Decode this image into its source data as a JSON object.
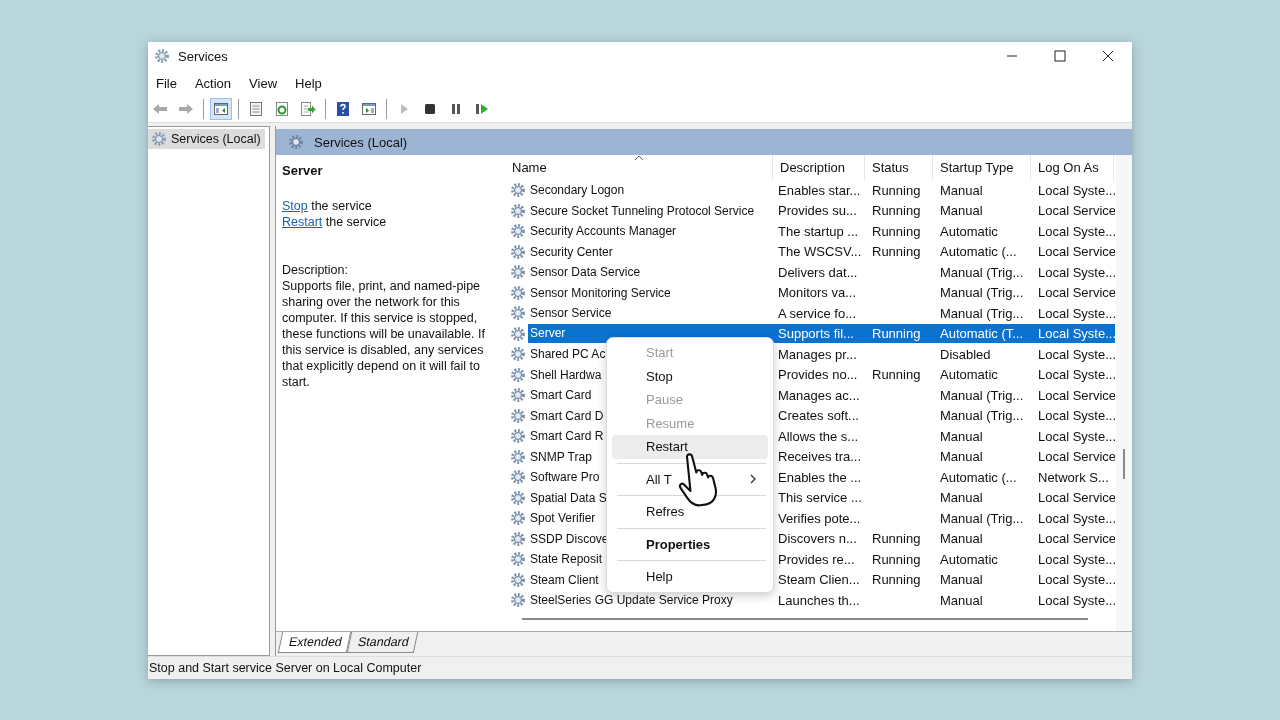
{
  "window": {
    "title": "Services"
  },
  "menu": [
    "File",
    "Action",
    "View",
    "Help"
  ],
  "toolbar": [
    {
      "kind": "back",
      "disabled": true,
      "selected": false
    },
    {
      "kind": "forward",
      "disabled": true,
      "selected": false
    },
    {
      "kind": "separator"
    },
    {
      "kind": "tree",
      "disabled": false,
      "selected": true
    },
    {
      "kind": "separator"
    },
    {
      "kind": "properties",
      "disabled": false,
      "selected": false
    },
    {
      "kind": "refresh",
      "disabled": false,
      "selected": false
    },
    {
      "kind": "export",
      "disabled": false,
      "selected": false
    },
    {
      "kind": "separator"
    },
    {
      "kind": "help",
      "disabled": false,
      "selected": false
    },
    {
      "kind": "view",
      "disabled": false,
      "selected": false
    },
    {
      "kind": "separator"
    },
    {
      "kind": "play",
      "disabled": true,
      "selected": false
    },
    {
      "kind": "stop",
      "disabled": false,
      "selected": false
    },
    {
      "kind": "pause",
      "disabled": false,
      "selected": false
    },
    {
      "kind": "resume",
      "disabled": false,
      "selected": false
    }
  ],
  "tree": {
    "items": [
      {
        "label": "Services (Local)",
        "selected": true
      }
    ]
  },
  "panel": {
    "header": "Services (Local)"
  },
  "details": {
    "title": "Server",
    "actions": [
      {
        "link": "Stop",
        "text": "the service"
      },
      {
        "link": "Restart",
        "text": "the service"
      }
    ],
    "description_label": "Description:",
    "description": "Supports file, print, and named-pipe sharing over the network for this computer. If this service is stopped, these functions will be unavailable. If this service is disabled, any services that explicitly depend on it will fail to start."
  },
  "table": {
    "columns": [
      {
        "label": "Name",
        "sorted": true
      },
      {
        "label": "Description",
        "sorted": false
      },
      {
        "label": "Status",
        "sorted": false
      },
      {
        "label": "Startup Type",
        "sorted": false
      },
      {
        "label": "Log On As",
        "sorted": false
      }
    ],
    "rows": [
      {
        "name": "Secondary Logon",
        "description": "Enables star...",
        "status": "Running",
        "startup_type": "Manual",
        "log_on_as": "Local Syste...",
        "selected": false
      },
      {
        "name": "Secure Socket Tunneling Protocol Service",
        "description": "Provides su...",
        "status": "Running",
        "startup_type": "Manual",
        "log_on_as": "Local Service",
        "selected": false
      },
      {
        "name": "Security Accounts Manager",
        "description": "The startup ...",
        "status": "Running",
        "startup_type": "Automatic",
        "log_on_as": "Local Syste...",
        "selected": false
      },
      {
        "name": "Security Center",
        "description": "The WSCSV...",
        "status": "Running",
        "startup_type": "Automatic (...",
        "log_on_as": "Local Service",
        "selected": false
      },
      {
        "name": "Sensor Data Service",
        "description": "Delivers dat...",
        "startup_type": "Manual (Trig...",
        "log_on_as": "Local Syste...",
        "selected": false
      },
      {
        "name": "Sensor Monitoring Service",
        "description": "Monitors va...",
        "startup_type": "Manual (Trig...",
        "log_on_as": "Local Service",
        "selected": false
      },
      {
        "name": "Sensor Service",
        "description": "A service fo...",
        "startup_type": "Manual (Trig...",
        "log_on_as": "Local Syste...",
        "selected": false
      },
      {
        "name": "Server",
        "description": "Supports fil...",
        "status": "Running",
        "startup_type": "Automatic (T...",
        "log_on_as": "Local Syste...",
        "selected": true
      },
      {
        "name": "Shared PC Ac",
        "description": "Manages pr...",
        "startup_type": "Disabled",
        "log_on_as": "Local Syste...",
        "selected": false
      },
      {
        "name": "Shell Hardwa",
        "description": "Provides no...",
        "status": "Running",
        "startup_type": "Automatic",
        "log_on_as": "Local Syste...",
        "selected": false
      },
      {
        "name": "Smart Card",
        "description": "Manages ac...",
        "startup_type": "Manual (Trig...",
        "log_on_as": "Local Service",
        "selected": false
      },
      {
        "name": "Smart Card D",
        "description": "Creates soft...",
        "startup_type": "Manual (Trig...",
        "log_on_as": "Local Syste...",
        "selected": false
      },
      {
        "name": "Smart Card R",
        "description": "Allows the s...",
        "startup_type": "Manual",
        "log_on_as": "Local Syste...",
        "selected": false
      },
      {
        "name": "SNMP Trap",
        "description": "Receives tra...",
        "startup_type": "Manual",
        "log_on_as": "Local Service",
        "selected": false
      },
      {
        "name": "Software Pro",
        "description": "Enables the ...",
        "startup_type": "Automatic (...",
        "log_on_as": "Network S...",
        "selected": false
      },
      {
        "name": "Spatial Data S",
        "description": "This service ...",
        "startup_type": "Manual",
        "log_on_as": "Local Service",
        "selected": false
      },
      {
        "name": "Spot Verifier",
        "description": "Verifies pote...",
        "startup_type": "Manual (Trig...",
        "log_on_as": "Local Syste...",
        "selected": false
      },
      {
        "name": "SSDP Discove",
        "description": "Discovers n...",
        "status": "Running",
        "startup_type": "Manual",
        "log_on_as": "Local Service",
        "selected": false
      },
      {
        "name": "State Reposit",
        "description": "Provides re...",
        "status": "Running",
        "startup_type": "Automatic",
        "log_on_as": "Local Syste...",
        "selected": false
      },
      {
        "name": "Steam Client",
        "description": "Steam Clien...",
        "status": "Running",
        "startup_type": "Manual",
        "log_on_as": "Local Syste...",
        "selected": false
      },
      {
        "name": "SteelSeries GG Update Service Proxy",
        "description": "Launches th...",
        "startup_type": "Manual",
        "log_on_as": "Local Syste...",
        "selected": false
      }
    ]
  },
  "context_menu": {
    "items": [
      {
        "kind": "item",
        "label": "Start",
        "disabled": true,
        "highlighted": false,
        "default": false,
        "submenu": false
      },
      {
        "kind": "item",
        "label": "Stop",
        "disabled": false,
        "highlighted": false,
        "default": false,
        "submenu": false
      },
      {
        "kind": "item",
        "label": "Pause",
        "disabled": true,
        "highlighted": false,
        "default": false,
        "submenu": false
      },
      {
        "kind": "item",
        "label": "Resume",
        "disabled": true,
        "highlighted": false,
        "default": false,
        "submenu": false
      },
      {
        "kind": "item",
        "label": "Restart",
        "disabled": false,
        "highlighted": true,
        "default": false,
        "submenu": false
      },
      {
        "kind": "separator"
      },
      {
        "kind": "item",
        "label": "All T",
        "disabled": false,
        "highlighted": false,
        "default": false,
        "submenu": true
      },
      {
        "kind": "separator"
      },
      {
        "kind": "item",
        "label": "Refres",
        "disabled": false,
        "highlighted": false,
        "default": false,
        "submenu": false
      },
      {
        "kind": "separator"
      },
      {
        "kind": "item",
        "label": "Properties",
        "disabled": false,
        "highlighted": false,
        "default": true,
        "submenu": false
      },
      {
        "kind": "separator"
      },
      {
        "kind": "item",
        "label": "Help",
        "disabled": false,
        "highlighted": false,
        "default": false,
        "submenu": false
      }
    ]
  },
  "tabs": [
    {
      "label": "Extended",
      "selected": true
    },
    {
      "label": "Standard",
      "selected": false
    }
  ],
  "status_bar": "Stop and Start service Server on Local Computer"
}
